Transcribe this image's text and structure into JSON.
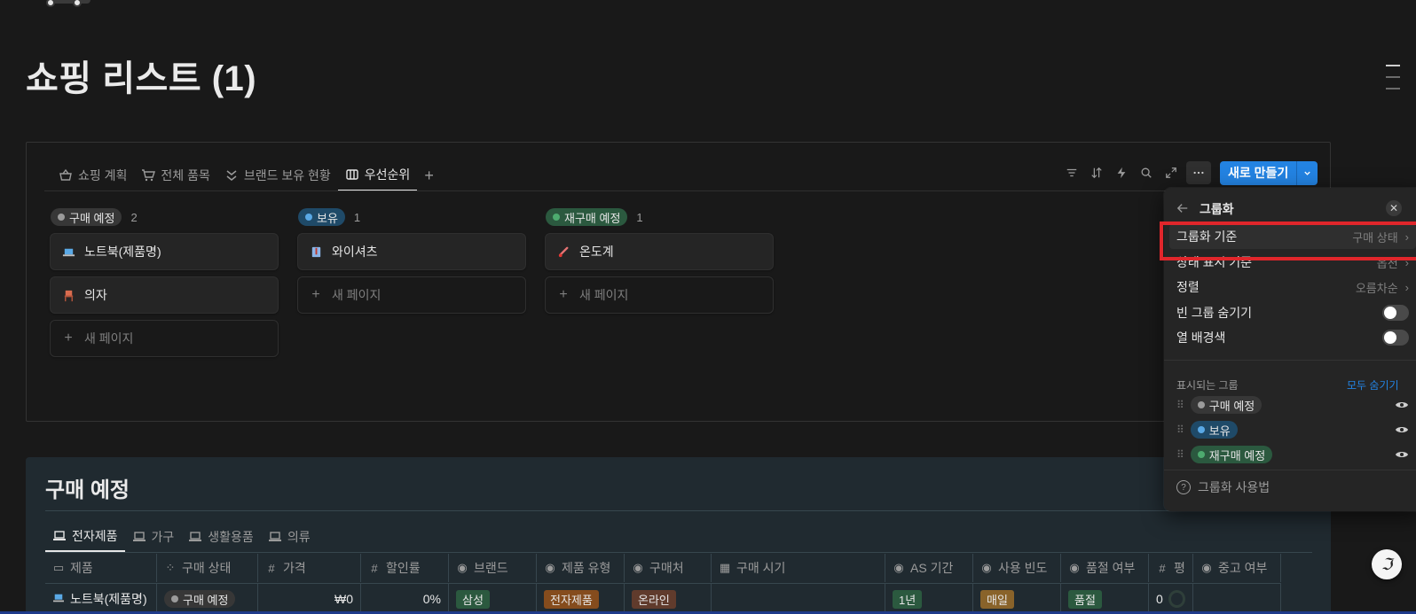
{
  "page": {
    "title": "쇼핑 리스트 (1)"
  },
  "views": {
    "tabs": [
      {
        "label": "쇼핑 계획",
        "icon": "basket-icon"
      },
      {
        "label": "전체 품목",
        "icon": "cart-icon"
      },
      {
        "label": "브랜드 보유 현황",
        "icon": "chevrons-down-icon"
      },
      {
        "label": "우선순위",
        "icon": "board-icon",
        "active": true
      }
    ],
    "add_label": "+"
  },
  "toolbar": {
    "new_label": "새로 만들기"
  },
  "board": {
    "columns": [
      {
        "status": "구매 예정",
        "count": "2",
        "color": "gray",
        "cards": [
          {
            "title": "노트북(제품명)",
            "icon": "laptop-icon"
          },
          {
            "title": "의자",
            "icon": "chair-icon"
          }
        ],
        "new_label": "새 페이지"
      },
      {
        "status": "보유",
        "count": "1",
        "color": "blue",
        "cards": [
          {
            "title": "와이셔츠",
            "icon": "shirt-icon"
          }
        ],
        "new_label": "새 페이지"
      },
      {
        "status": "재구매 예정",
        "count": "1",
        "color": "green",
        "cards": [
          {
            "title": "온도계",
            "icon": "thermometer-icon"
          }
        ],
        "new_label": "새 페이지"
      }
    ]
  },
  "section": {
    "title": "구매 예정",
    "tabs": [
      {
        "label": "전자제품",
        "active": true
      },
      {
        "label": "가구"
      },
      {
        "label": "생활용품"
      },
      {
        "label": "의류"
      }
    ],
    "columns": [
      "제품",
      "구매 상태",
      "가격",
      "할인률",
      "브랜드",
      "제품 유형",
      "구매처",
      "구매 시기",
      "AS 기간",
      "사용 빈도",
      "품절 여부",
      "평",
      "중고 여부"
    ],
    "row": {
      "product": "노트북(제품명)",
      "status": "구매 예정",
      "price": "₩0",
      "discount": "0%",
      "brand": "삼성",
      "type": "전자제품",
      "store": "온라인",
      "as_period": "1년",
      "frequency": "매일",
      "soldout": "품절",
      "rating": "0"
    }
  },
  "panel": {
    "title": "그룹화",
    "rows": [
      {
        "label": "그룹화 기준",
        "value": "구매 상태"
      },
      {
        "label": "상태 표시 기준",
        "value": "옵션"
      },
      {
        "label": "정렬",
        "value": "오름차순"
      },
      {
        "label": "빈 그룹 숨기기",
        "value": ""
      },
      {
        "label": "열 배경색",
        "value": ""
      }
    ],
    "visible_groups_label": "표시되는 그룹",
    "hide_all_label": "모두 숨기기",
    "groups": [
      "구매 예정",
      "보유",
      "재구매 예정"
    ],
    "help_label": "그룹화 사용법"
  }
}
